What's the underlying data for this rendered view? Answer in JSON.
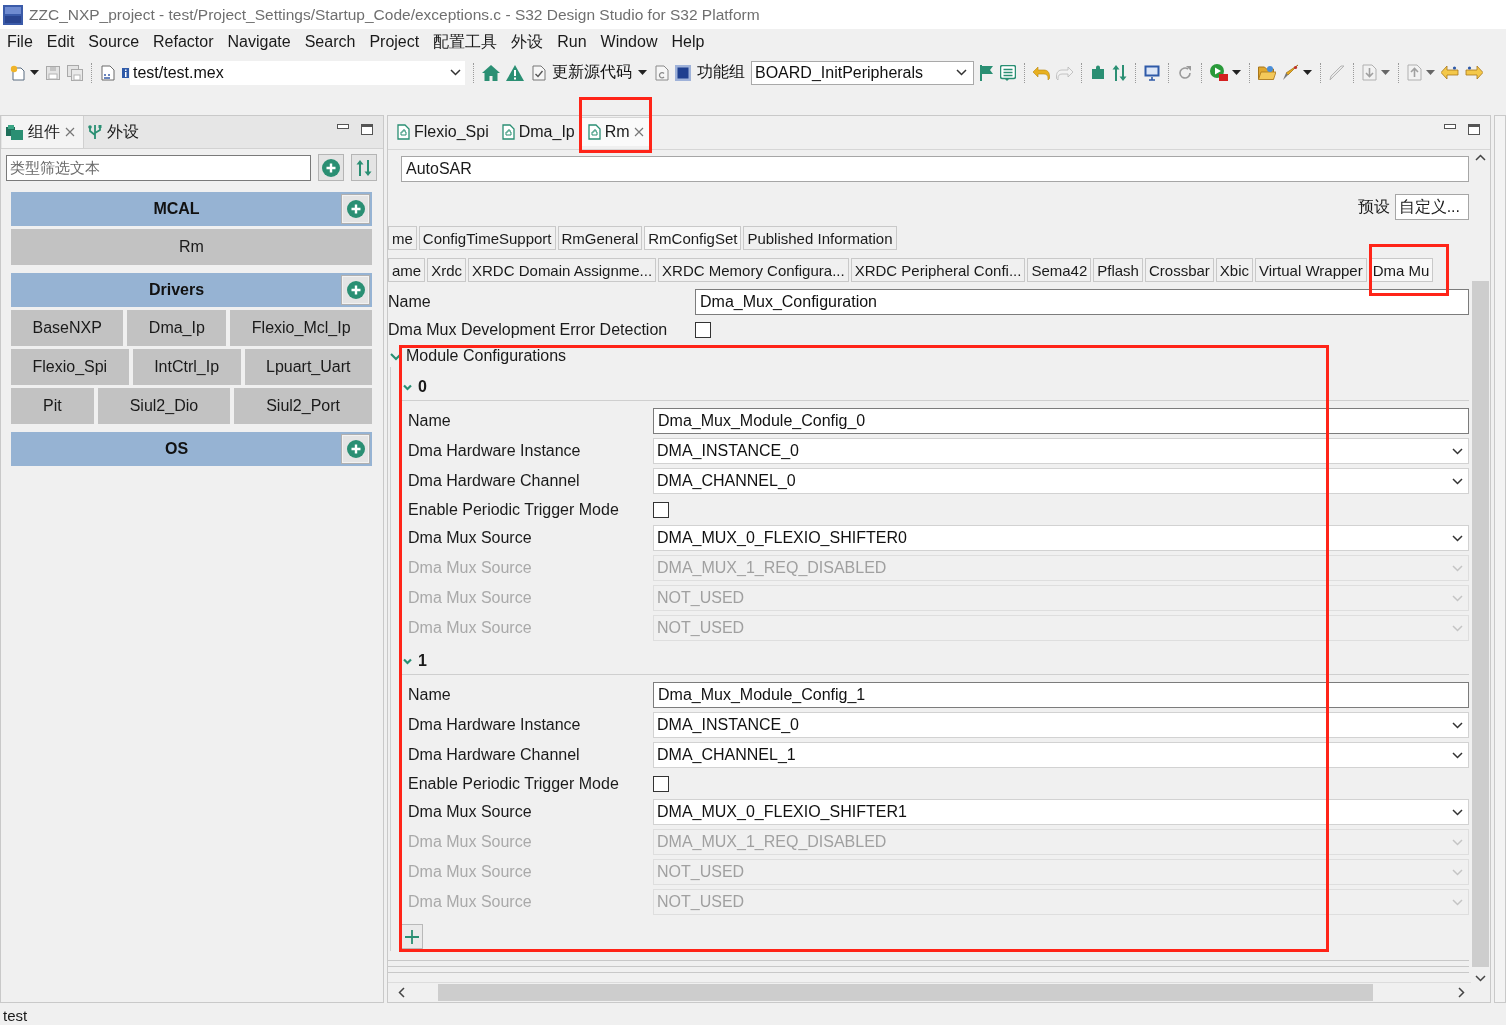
{
  "window": {
    "title": "ZZC_NXP_project - test/Project_Settings/Startup_Code/exceptions.c - S32 Design Studio for S32 Platform"
  },
  "menu": [
    "File",
    "Edit",
    "Source",
    "Refactor",
    "Navigate",
    "Search",
    "Project",
    "配置工具",
    "外设",
    "Run",
    "Window",
    "Help"
  ],
  "toolbar": {
    "mex_file": "test/test.mex",
    "update_code_button": "更新源代码",
    "function_group_label": "功能组",
    "function_group": "BOARD_InitPeripherals"
  },
  "components_panel": {
    "tabs": [
      {
        "label": "组件",
        "selected": true
      },
      {
        "label": "外设",
        "selected": false
      }
    ],
    "filter": {
      "placeholder": "类型筛选文本"
    },
    "groups": [
      {
        "name": "MCAL",
        "rows": [
          [
            "Rm"
          ]
        ]
      },
      {
        "name": "Drivers",
        "rows": [
          [
            "BaseNXP",
            "Dma_Ip",
            "Flexio_Mcl_Ip"
          ],
          [
            "Flexio_Spi",
            "IntCtrl_Ip",
            "Lpuart_Uart"
          ],
          [
            "Pit",
            "Siul2_Dio",
            "Siul2_Port"
          ]
        ]
      },
      {
        "name": "OS"
      }
    ]
  },
  "editor": {
    "tabs": [
      {
        "label": "Flexio_Spi",
        "selected": false,
        "highlighted": false
      },
      {
        "label": "Dma_Ip",
        "selected": false,
        "highlighted": false
      },
      {
        "label": "Rm",
        "selected": true,
        "highlighted": true
      }
    ],
    "mode_value": "AutoSAR",
    "preset": {
      "label": "预设",
      "value": "自定义..."
    },
    "section_tabs": [
      [
        {
          "label": "me",
          "selected": false,
          "highlighted": false
        },
        {
          "label": "ConfigTimeSupport",
          "selected": false,
          "highlighted": false
        },
        {
          "label": "RmGeneral",
          "selected": false,
          "highlighted": false
        },
        {
          "label": "RmConfigSet",
          "selected": true,
          "highlighted": false
        },
        {
          "label": "Published Information",
          "selected": false,
          "highlighted": false
        }
      ],
      [
        {
          "label": "ame",
          "selected": false,
          "highlighted": false
        },
        {
          "label": "Xrdc",
          "selected": false,
          "highlighted": false
        },
        {
          "label": "XRDC Domain Assignme...",
          "selected": false,
          "highlighted": false
        },
        {
          "label": "XRDC Memory Configura...",
          "selected": false,
          "highlighted": false
        },
        {
          "label": "XRDC Peripheral Confi...",
          "selected": false,
          "highlighted": false
        },
        {
          "label": "Sema42",
          "selected": false,
          "highlighted": false
        },
        {
          "label": "Pflash",
          "selected": false,
          "highlighted": false
        },
        {
          "label": "Crossbar",
          "selected": false,
          "highlighted": false
        },
        {
          "label": "Xbic",
          "selected": false,
          "highlighted": false
        },
        {
          "label": "Virtual Wrapper",
          "selected": false,
          "highlighted": false
        },
        {
          "label": "Dma Mu",
          "selected": true,
          "highlighted": true
        }
      ]
    ],
    "name": {
      "label": "Name",
      "value": "Dma_Mux_Configuration"
    },
    "error_detection": {
      "label": "Dma Mux Development Error Detection",
      "checked": false
    },
    "module_configurations": {
      "title": "Module Configurations",
      "expanded": true,
      "highlighted": true,
      "groups": [
        {
          "title": "0",
          "expanded": true,
          "fields": [
            {
              "kind": "text",
              "label": "Name",
              "value": "Dma_Mux_Module_Config_0",
              "disabled": false
            },
            {
              "kind": "dropdown",
              "label": "Dma Hardware Instance",
              "value": "DMA_INSTANCE_0",
              "disabled": false
            },
            {
              "kind": "dropdown",
              "label": "Dma Hardware Channel",
              "value": "DMA_CHANNEL_0",
              "disabled": false
            },
            {
              "kind": "checkbox",
              "label": "Enable Periodic Trigger Mode",
              "checked": false,
              "disabled": false
            },
            {
              "kind": "dropdown",
              "label": "Dma Mux Source",
              "value": "DMA_MUX_0_FLEXIO_SHIFTER0",
              "disabled": false
            },
            {
              "kind": "dropdown",
              "label": "Dma Mux Source",
              "value": "DMA_MUX_1_REQ_DISABLED",
              "disabled": true
            },
            {
              "kind": "dropdown",
              "label": "Dma Mux Source",
              "value": "NOT_USED",
              "disabled": true
            },
            {
              "kind": "dropdown",
              "label": "Dma Mux Source",
              "value": "NOT_USED",
              "disabled": true
            }
          ]
        },
        {
          "title": "1",
          "expanded": true,
          "fields": [
            {
              "kind": "text",
              "label": "Name",
              "value": "Dma_Mux_Module_Config_1",
              "disabled": false
            },
            {
              "kind": "dropdown",
              "label": "Dma Hardware Instance",
              "value": "DMA_INSTANCE_0",
              "disabled": false
            },
            {
              "kind": "dropdown",
              "label": "Dma Hardware Channel",
              "value": "DMA_CHANNEL_1",
              "disabled": false
            },
            {
              "kind": "checkbox",
              "label": "Enable Periodic Trigger Mode",
              "checked": false,
              "disabled": false
            },
            {
              "kind": "dropdown",
              "label": "Dma Mux Source",
              "value": "DMA_MUX_0_FLEXIO_SHIFTER1",
              "disabled": false
            },
            {
              "kind": "dropdown",
              "label": "Dma Mux Source",
              "value": "DMA_MUX_1_REQ_DISABLED",
              "disabled": true
            },
            {
              "kind": "dropdown",
              "label": "Dma Mux Source",
              "value": "NOT_USED",
              "disabled": true
            },
            {
              "kind": "dropdown",
              "label": "Dma Mux Source",
              "value": "NOT_USED",
              "disabled": true
            }
          ]
        }
      ]
    }
  },
  "status_bar": {
    "text": "test"
  }
}
